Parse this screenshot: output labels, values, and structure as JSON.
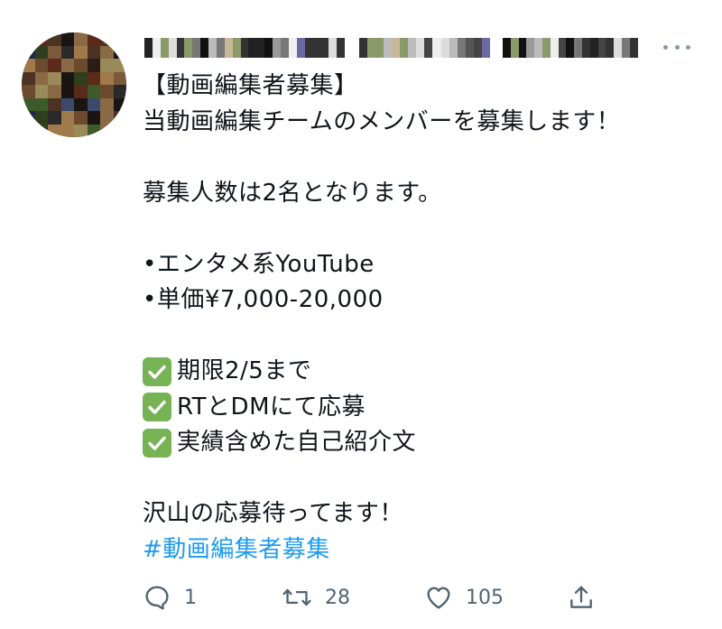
{
  "tweet": {
    "lines": [
      "【動画編集者募集】",
      "当動画編集チームのメンバーを募集します！",
      "",
      "募集人数は2名となります。",
      "",
      "•エンタメ系YouTube",
      "•単価¥7,000-20,000",
      "",
      "期限2/5まで",
      "RTとDMにて応募",
      "実績含めた自己紹介文",
      "",
      "沢山の応募待ってます！"
    ],
    "checklist_icon": "check-mark-button-emoji",
    "hashtag": "#動画編集者募集"
  },
  "author": {
    "avatar_icon": "pixelated-avatar",
    "name_icon": "pixelated-name-and-handle"
  },
  "actions": {
    "reply_count": "1",
    "retweet_count": "28",
    "like_count": "105"
  },
  "colors": {
    "text": "#0f1419",
    "hashtag": "#1d9bf0",
    "secondary": "#536471",
    "check_green": "#77b255"
  }
}
